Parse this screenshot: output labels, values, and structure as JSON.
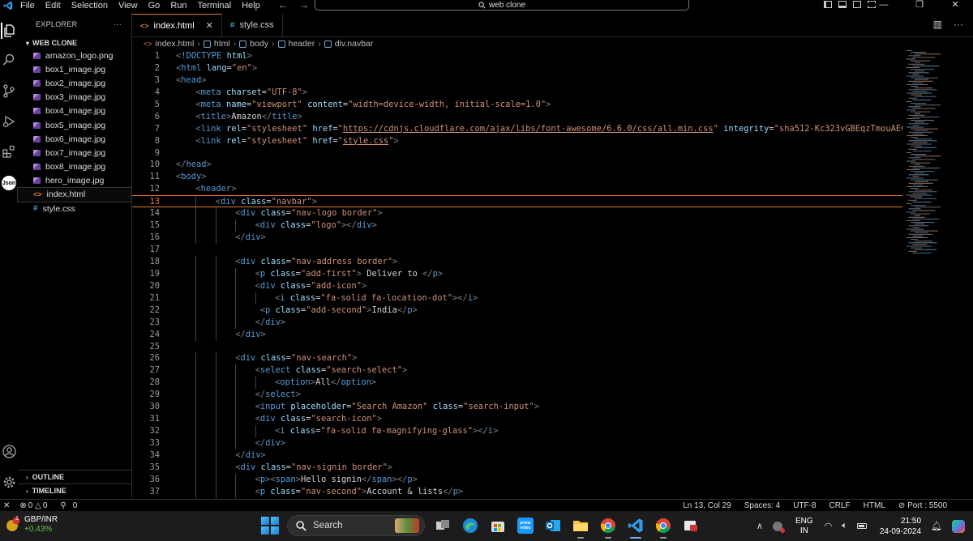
{
  "menu": [
    "File",
    "Edit",
    "Selection",
    "View",
    "Go",
    "Run",
    "Terminal",
    "Help"
  ],
  "command_center": "web clone",
  "sidebar": {
    "title": "EXPLORER",
    "more": "···",
    "folder": "WEB CLONE",
    "files": [
      {
        "name": "amazon_logo.png",
        "type": "image"
      },
      {
        "name": "box1_image.jpg",
        "type": "image"
      },
      {
        "name": "box2_image.jpg",
        "type": "image"
      },
      {
        "name": "box3_image.jpg",
        "type": "image"
      },
      {
        "name": "box4_image.jpg",
        "type": "image"
      },
      {
        "name": "box5_image.jpg",
        "type": "image"
      },
      {
        "name": "box6_image.jpg",
        "type": "image"
      },
      {
        "name": "box7_image.jpg",
        "type": "image"
      },
      {
        "name": "box8_image.jpg",
        "type": "image"
      },
      {
        "name": "hero_image.jpg",
        "type": "image"
      },
      {
        "name": "index.html",
        "type": "html"
      },
      {
        "name": "style.css",
        "type": "css"
      }
    ],
    "outline": "OUTLINE",
    "timeline": "TIMELINE"
  },
  "tabs": [
    {
      "label": "index.html",
      "type": "html",
      "active": true
    },
    {
      "label": "style.css",
      "type": "css",
      "active": false
    }
  ],
  "breadcrumb": [
    "index.html",
    "html",
    "body",
    "header",
    "div.navbar"
  ],
  "current_line": 13,
  "code_lines": [
    {
      "n": 1,
      "indent": 0,
      "tokens": [
        [
          "p",
          "<"
        ],
        [
          "t",
          "!DOCTYPE"
        ],
        [
          "x",
          " "
        ],
        [
          "a",
          "html"
        ],
        [
          "p",
          ">"
        ]
      ]
    },
    {
      "n": 2,
      "indent": 0,
      "tokens": [
        [
          "p",
          "<"
        ],
        [
          "t",
          "html"
        ],
        [
          "x",
          " "
        ],
        [
          "a",
          "lang"
        ],
        [
          "x",
          "="
        ],
        [
          "s",
          "\"en\""
        ],
        [
          "p",
          ">"
        ]
      ]
    },
    {
      "n": 3,
      "indent": 0,
      "tokens": [
        [
          "p",
          "<"
        ],
        [
          "t",
          "head"
        ],
        [
          "p",
          ">"
        ]
      ]
    },
    {
      "n": 4,
      "indent": 1,
      "tokens": [
        [
          "p",
          "<"
        ],
        [
          "t",
          "meta"
        ],
        [
          "x",
          " "
        ],
        [
          "a",
          "charset"
        ],
        [
          "x",
          "="
        ],
        [
          "s",
          "\"UTF-8\""
        ],
        [
          "p",
          ">"
        ]
      ]
    },
    {
      "n": 5,
      "indent": 1,
      "tokens": [
        [
          "p",
          "<"
        ],
        [
          "t",
          "meta"
        ],
        [
          "x",
          " "
        ],
        [
          "a",
          "name"
        ],
        [
          "x",
          "="
        ],
        [
          "s",
          "\"viewport\""
        ],
        [
          "x",
          " "
        ],
        [
          "a",
          "content"
        ],
        [
          "x",
          "="
        ],
        [
          "s",
          "\"width=device-width, initial-scale=1.0\""
        ],
        [
          "p",
          ">"
        ]
      ]
    },
    {
      "n": 6,
      "indent": 1,
      "tokens": [
        [
          "p",
          "<"
        ],
        [
          "t",
          "title"
        ],
        [
          "p",
          ">"
        ],
        [
          "x",
          "Amazon"
        ],
        [
          "p",
          "</"
        ],
        [
          "t",
          "title"
        ],
        [
          "p",
          ">"
        ]
      ]
    },
    {
      "n": 7,
      "indent": 1,
      "tokens": [
        [
          "p",
          "<"
        ],
        [
          "t",
          "link"
        ],
        [
          "x",
          " "
        ],
        [
          "a",
          "rel"
        ],
        [
          "x",
          "="
        ],
        [
          "s",
          "\"stylesheet\""
        ],
        [
          "x",
          " "
        ],
        [
          "a",
          "href"
        ],
        [
          "x",
          "="
        ],
        [
          "s",
          "\""
        ],
        [
          "su",
          "https://cdnjs.cloudflare.com/ajax/libs/font-awesome/6.6.0/css/all.min.css"
        ],
        [
          "s",
          "\""
        ],
        [
          "x",
          " "
        ],
        [
          "a",
          "integrity"
        ],
        [
          "x",
          "="
        ],
        [
          "s",
          "\"sha512-Kc323vGBEqzTmouAECnVce"
        ]
      ]
    },
    {
      "n": 8,
      "indent": 1,
      "tokens": [
        [
          "p",
          "<"
        ],
        [
          "t",
          "link"
        ],
        [
          "x",
          " "
        ],
        [
          "a",
          "rel"
        ],
        [
          "x",
          "="
        ],
        [
          "s",
          "\"stylesheet\""
        ],
        [
          "x",
          " "
        ],
        [
          "a",
          "href"
        ],
        [
          "x",
          "="
        ],
        [
          "s",
          "\""
        ],
        [
          "su",
          "style.css"
        ],
        [
          "s",
          "\""
        ],
        [
          "p",
          ">"
        ]
      ]
    },
    {
      "n": 9,
      "indent": 0,
      "tokens": []
    },
    {
      "n": 10,
      "indent": 0,
      "tokens": [
        [
          "p",
          "</"
        ],
        [
          "t",
          "head"
        ],
        [
          "p",
          ">"
        ]
      ]
    },
    {
      "n": 11,
      "indent": 0,
      "tokens": [
        [
          "p",
          "<"
        ],
        [
          "t",
          "body"
        ],
        [
          "p",
          ">"
        ]
      ]
    },
    {
      "n": 12,
      "indent": 1,
      "tokens": [
        [
          "p",
          "<"
        ],
        [
          "t",
          "header"
        ],
        [
          "p",
          ">"
        ]
      ]
    },
    {
      "n": 13,
      "indent": 2,
      "tokens": [
        [
          "p",
          "<"
        ],
        [
          "t",
          "div"
        ],
        [
          "x",
          " "
        ],
        [
          "a",
          "class"
        ],
        [
          "x",
          "="
        ],
        [
          "s",
          "\"navbar\""
        ],
        [
          "p",
          ">"
        ]
      ]
    },
    {
      "n": 14,
      "indent": 3,
      "tokens": [
        [
          "p",
          "<"
        ],
        [
          "t",
          "div"
        ],
        [
          "x",
          " "
        ],
        [
          "a",
          "class"
        ],
        [
          "x",
          "="
        ],
        [
          "s",
          "\"nav-logo border\""
        ],
        [
          "p",
          ">"
        ]
      ]
    },
    {
      "n": 15,
      "indent": 4,
      "tokens": [
        [
          "p",
          "<"
        ],
        [
          "t",
          "div"
        ],
        [
          "x",
          " "
        ],
        [
          "a",
          "class"
        ],
        [
          "x",
          "="
        ],
        [
          "s",
          "\"logo\""
        ],
        [
          "p",
          "></"
        ],
        [
          "t",
          "div"
        ],
        [
          "p",
          ">"
        ]
      ]
    },
    {
      "n": 16,
      "indent": 3,
      "tokens": [
        [
          "p",
          "</"
        ],
        [
          "t",
          "div"
        ],
        [
          "p",
          ">"
        ]
      ]
    },
    {
      "n": 17,
      "indent": 0,
      "tokens": []
    },
    {
      "n": 18,
      "indent": 3,
      "tokens": [
        [
          "p",
          "<"
        ],
        [
          "t",
          "div"
        ],
        [
          "x",
          " "
        ],
        [
          "a",
          "class"
        ],
        [
          "x",
          "="
        ],
        [
          "s",
          "\"nav-address border\""
        ],
        [
          "p",
          ">"
        ]
      ]
    },
    {
      "n": 19,
      "indent": 4,
      "tokens": [
        [
          "p",
          "<"
        ],
        [
          "t",
          "p"
        ],
        [
          "x",
          " "
        ],
        [
          "a",
          "class"
        ],
        [
          "x",
          "="
        ],
        [
          "s",
          "\"add-first\""
        ],
        [
          "p",
          ">"
        ],
        [
          "x",
          " Deliver to "
        ],
        [
          "p",
          "</"
        ],
        [
          "t",
          "p"
        ],
        [
          "p",
          ">"
        ]
      ]
    },
    {
      "n": 20,
      "indent": 4,
      "tokens": [
        [
          "p",
          "<"
        ],
        [
          "t",
          "div"
        ],
        [
          "x",
          " "
        ],
        [
          "a",
          "class"
        ],
        [
          "x",
          "="
        ],
        [
          "s",
          "\"add-icon\""
        ],
        [
          "p",
          ">"
        ]
      ]
    },
    {
      "n": 21,
      "indent": 5,
      "tokens": [
        [
          "p",
          "<"
        ],
        [
          "t",
          "i"
        ],
        [
          "x",
          " "
        ],
        [
          "a",
          "class"
        ],
        [
          "x",
          "="
        ],
        [
          "s",
          "\"fa-solid fa-location-dot\""
        ],
        [
          "p",
          "></"
        ],
        [
          "t",
          "i"
        ],
        [
          "p",
          ">"
        ]
      ]
    },
    {
      "n": 22,
      "indent": 4,
      "tokens": [
        [
          "x",
          " "
        ],
        [
          "p",
          "<"
        ],
        [
          "t",
          "p"
        ],
        [
          "x",
          " "
        ],
        [
          "a",
          "class"
        ],
        [
          "x",
          "="
        ],
        [
          "s",
          "\"add-second\""
        ],
        [
          "p",
          ">"
        ],
        [
          "x",
          "India"
        ],
        [
          "p",
          "</"
        ],
        [
          "t",
          "p"
        ],
        [
          "p",
          ">"
        ]
      ]
    },
    {
      "n": 23,
      "indent": 4,
      "tokens": [
        [
          "p",
          "</"
        ],
        [
          "t",
          "div"
        ],
        [
          "p",
          ">"
        ]
      ]
    },
    {
      "n": 24,
      "indent": 3,
      "tokens": [
        [
          "p",
          "</"
        ],
        [
          "t",
          "div"
        ],
        [
          "p",
          ">"
        ]
      ]
    },
    {
      "n": 25,
      "indent": 0,
      "tokens": []
    },
    {
      "n": 26,
      "indent": 3,
      "tokens": [
        [
          "p",
          "<"
        ],
        [
          "t",
          "div"
        ],
        [
          "x",
          " "
        ],
        [
          "a",
          "class"
        ],
        [
          "x",
          "="
        ],
        [
          "s",
          "\"nav-search\""
        ],
        [
          "p",
          ">"
        ]
      ]
    },
    {
      "n": 27,
      "indent": 4,
      "tokens": [
        [
          "p",
          "<"
        ],
        [
          "t",
          "select"
        ],
        [
          "x",
          " "
        ],
        [
          "a",
          "class"
        ],
        [
          "x",
          "="
        ],
        [
          "s",
          "\"search-select\""
        ],
        [
          "p",
          ">"
        ]
      ]
    },
    {
      "n": 28,
      "indent": 5,
      "tokens": [
        [
          "p",
          "<"
        ],
        [
          "t",
          "option"
        ],
        [
          "p",
          ">"
        ],
        [
          "x",
          "All"
        ],
        [
          "p",
          "</"
        ],
        [
          "t",
          "option"
        ],
        [
          "p",
          ">"
        ]
      ]
    },
    {
      "n": 29,
      "indent": 4,
      "tokens": [
        [
          "p",
          "</"
        ],
        [
          "t",
          "select"
        ],
        [
          "p",
          ">"
        ]
      ]
    },
    {
      "n": 30,
      "indent": 4,
      "tokens": [
        [
          "p",
          "<"
        ],
        [
          "t",
          "input"
        ],
        [
          "x",
          " "
        ],
        [
          "a",
          "placeholder"
        ],
        [
          "x",
          "="
        ],
        [
          "s",
          "\"Search Amazon\""
        ],
        [
          "x",
          " "
        ],
        [
          "a",
          "class"
        ],
        [
          "x",
          "="
        ],
        [
          "s",
          "\"search-input\""
        ],
        [
          "p",
          ">"
        ]
      ]
    },
    {
      "n": 31,
      "indent": 4,
      "tokens": [
        [
          "p",
          "<"
        ],
        [
          "t",
          "div"
        ],
        [
          "x",
          " "
        ],
        [
          "a",
          "class"
        ],
        [
          "x",
          "="
        ],
        [
          "s",
          "\"search-icon\""
        ],
        [
          "p",
          ">"
        ]
      ]
    },
    {
      "n": 32,
      "indent": 5,
      "tokens": [
        [
          "p",
          "<"
        ],
        [
          "t",
          "i"
        ],
        [
          "x",
          " "
        ],
        [
          "a",
          "class"
        ],
        [
          "x",
          "="
        ],
        [
          "s",
          "\"fa-solid fa-magnifying-glass\""
        ],
        [
          "p",
          "></"
        ],
        [
          "t",
          "i"
        ],
        [
          "p",
          ">"
        ]
      ]
    },
    {
      "n": 33,
      "indent": 4,
      "tokens": [
        [
          "p",
          "</"
        ],
        [
          "t",
          "div"
        ],
        [
          "p",
          ">"
        ]
      ]
    },
    {
      "n": 34,
      "indent": 3,
      "tokens": [
        [
          "p",
          "</"
        ],
        [
          "t",
          "div"
        ],
        [
          "p",
          ">"
        ]
      ]
    },
    {
      "n": 35,
      "indent": 3,
      "tokens": [
        [
          "p",
          "<"
        ],
        [
          "t",
          "div"
        ],
        [
          "x",
          " "
        ],
        [
          "a",
          "class"
        ],
        [
          "x",
          "="
        ],
        [
          "s",
          "\"nav-signin border\""
        ],
        [
          "p",
          ">"
        ]
      ]
    },
    {
      "n": 36,
      "indent": 4,
      "tokens": [
        [
          "p",
          "<"
        ],
        [
          "t",
          "p"
        ],
        [
          "p",
          "><"
        ],
        [
          "t",
          "span"
        ],
        [
          "p",
          ">"
        ],
        [
          "x",
          "Hello signin"
        ],
        [
          "p",
          "</"
        ],
        [
          "t",
          "span"
        ],
        [
          "p",
          "></"
        ],
        [
          "t",
          "p"
        ],
        [
          "p",
          ">"
        ]
      ]
    },
    {
      "n": 37,
      "indent": 4,
      "tokens": [
        [
          "p",
          "<"
        ],
        [
          "t",
          "p"
        ],
        [
          "x",
          " "
        ],
        [
          "a",
          "class"
        ],
        [
          "x",
          "="
        ],
        [
          "s",
          "\"nav-second\""
        ],
        [
          "p",
          ">"
        ],
        [
          "x",
          "Account & lists"
        ],
        [
          "p",
          "</"
        ],
        [
          "t",
          "p"
        ],
        [
          "p",
          ">"
        ]
      ]
    }
  ],
  "status": {
    "errors": "0",
    "warnings": "0",
    "ports_fwd": "0",
    "position": "Ln 13, Col 29",
    "spaces": "Spaces: 4",
    "encoding": "UTF-8",
    "eol": "CRLF",
    "language": "HTML",
    "port": "Port : 5500"
  },
  "taskbar": {
    "ticker_name": "GBP/INR",
    "ticker_change": "+0.43%",
    "notif_count": "1",
    "search_label": "Search",
    "lang_line1": "ENG",
    "lang_line2": "IN",
    "time": "21:50",
    "date": "24-09-2024"
  },
  "colors": {
    "accent": "#e37933",
    "tag": "#569cd6",
    "attr": "#9cdcfe",
    "string": "#ce9178"
  }
}
